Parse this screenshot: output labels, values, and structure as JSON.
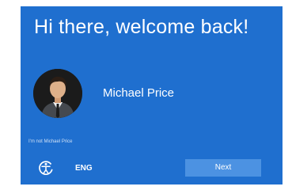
{
  "greeting": "Hi there, welcome back!",
  "user": {
    "name": "Michael Price",
    "not_you_link": "I'm not Michael Price"
  },
  "footer": {
    "accessibility_icon": "ease-of-access-icon",
    "language": "ENG",
    "next_label": "Next"
  },
  "colors": {
    "panel_background": "#1f6fcf",
    "next_button": "#4c92e2",
    "text": "#ffffff"
  }
}
